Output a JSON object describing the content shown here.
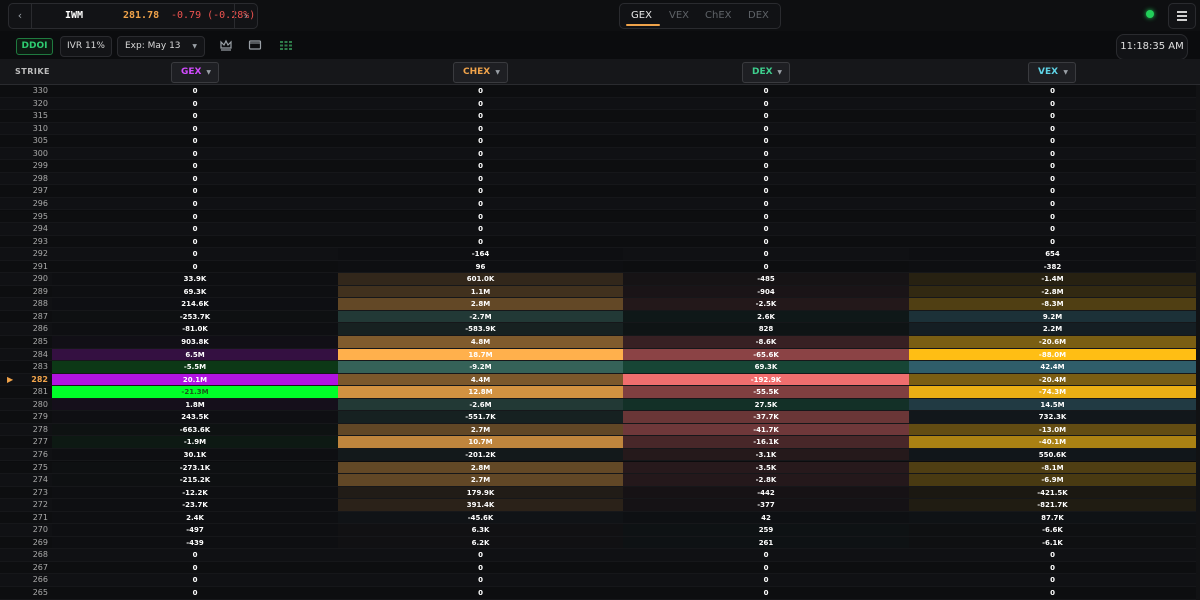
{
  "ticker": {
    "prev": "‹",
    "next": "›",
    "symbol": "IWM",
    "price": "281.78",
    "change": "-0.79 (-0.28%)"
  },
  "tabs": [
    {
      "label": "GEX",
      "active": true
    },
    {
      "label": "VEX",
      "active": false
    },
    {
      "label": "ChEX",
      "active": false
    },
    {
      "label": "DEX",
      "active": false
    }
  ],
  "toolbar": {
    "ddoi": "DDOI",
    "ivr": "IVR 11%",
    "expiry": "Exp: May 13",
    "time": "11:18:35 AM"
  },
  "columns": {
    "strike": "STRIKE",
    "gex": "GEX",
    "chex": "CHEX",
    "dex": "DEX",
    "vex": "VEX"
  },
  "colors": {
    "gex": "#d24bff",
    "chex": "#f0a34a",
    "dex": "#3ecf8e",
    "vex": "#5fd3e6",
    "accent": "#f0a34a",
    "live": "#22d05a"
  },
  "current_strike": "282",
  "rows": [
    {
      "strike": "330",
      "gex": "0",
      "chex": "0",
      "dex": "0",
      "vex": "0"
    },
    {
      "strike": "320",
      "gex": "0",
      "chex": "0",
      "dex": "0",
      "vex": "0"
    },
    {
      "strike": "315",
      "gex": "0",
      "chex": "0",
      "dex": "0",
      "vex": "0"
    },
    {
      "strike": "310",
      "gex": "0",
      "chex": "0",
      "dex": "0",
      "vex": "0"
    },
    {
      "strike": "305",
      "gex": "0",
      "chex": "0",
      "dex": "0",
      "vex": "0"
    },
    {
      "strike": "300",
      "gex": "0",
      "chex": "0",
      "dex": "0",
      "vex": "0"
    },
    {
      "strike": "299",
      "gex": "0",
      "chex": "0",
      "dex": "0",
      "vex": "0"
    },
    {
      "strike": "298",
      "gex": "0",
      "chex": "0",
      "dex": "0",
      "vex": "0"
    },
    {
      "strike": "297",
      "gex": "0",
      "chex": "0",
      "dex": "0",
      "vex": "0"
    },
    {
      "strike": "296",
      "gex": "0",
      "chex": "0",
      "dex": "0",
      "vex": "0"
    },
    {
      "strike": "295",
      "gex": "0",
      "chex": "0",
      "dex": "0",
      "vex": "0"
    },
    {
      "strike": "294",
      "gex": "0",
      "chex": "0",
      "dex": "0",
      "vex": "0"
    },
    {
      "strike": "293",
      "gex": "0",
      "chex": "0",
      "dex": "0",
      "vex": "0"
    },
    {
      "strike": "292",
      "gex": "0",
      "chex": "-164",
      "dex": "0",
      "vex": "654"
    },
    {
      "strike": "291",
      "gex": "0",
      "chex": "96",
      "dex": "0",
      "vex": "-382"
    },
    {
      "strike": "290",
      "gex": "33.9K",
      "chex": "601.0K",
      "dex": "-485",
      "vex": "-1.4M"
    },
    {
      "strike": "289",
      "gex": "69.3K",
      "chex": "1.1M",
      "dex": "-904",
      "vex": "-2.8M"
    },
    {
      "strike": "288",
      "gex": "214.6K",
      "chex": "2.8M",
      "dex": "-2.5K",
      "vex": "-8.3M"
    },
    {
      "strike": "287",
      "gex": "-253.7K",
      "chex": "-2.7M",
      "dex": "2.6K",
      "vex": "9.2M"
    },
    {
      "strike": "286",
      "gex": "-81.0K",
      "chex": "-583.9K",
      "dex": "828",
      "vex": "2.2M"
    },
    {
      "strike": "285",
      "gex": "903.8K",
      "chex": "4.8M",
      "dex": "-8.6K",
      "vex": "-20.6M"
    },
    {
      "strike": "284",
      "gex": "6.5M",
      "chex": "18.7M",
      "dex": "-65.6K",
      "vex": "-88.0M"
    },
    {
      "strike": "283",
      "gex": "-5.5M",
      "chex": "-9.2M",
      "dex": "69.3K",
      "vex": "42.4M"
    },
    {
      "strike": "282",
      "gex": "20.1M",
      "chex": "4.4M",
      "dex": "-192.9K",
      "vex": "-20.4M"
    },
    {
      "strike": "281",
      "gex": "-21.3M",
      "chex": "12.8M",
      "dex": "-55.5K",
      "vex": "-74.3M"
    },
    {
      "strike": "280",
      "gex": "1.8M",
      "chex": "-2.6M",
      "dex": "27.5K",
      "vex": "14.5M"
    },
    {
      "strike": "279",
      "gex": "243.5K",
      "chex": "-551.7K",
      "dex": "-37.7K",
      "vex": "732.3K"
    },
    {
      "strike": "278",
      "gex": "-663.6K",
      "chex": "2.7M",
      "dex": "-41.7K",
      "vex": "-13.0M"
    },
    {
      "strike": "277",
      "gex": "-1.9M",
      "chex": "10.7M",
      "dex": "-16.1K",
      "vex": "-40.1M"
    },
    {
      "strike": "276",
      "gex": "30.1K",
      "chex": "-201.2K",
      "dex": "-3.1K",
      "vex": "550.6K"
    },
    {
      "strike": "275",
      "gex": "-273.1K",
      "chex": "2.8M",
      "dex": "-3.5K",
      "vex": "-8.1M"
    },
    {
      "strike": "274",
      "gex": "-215.2K",
      "chex": "2.7M",
      "dex": "-2.8K",
      "vex": "-6.9M"
    },
    {
      "strike": "273",
      "gex": "-12.2K",
      "chex": "179.9K",
      "dex": "-442",
      "vex": "-421.5K"
    },
    {
      "strike": "272",
      "gex": "-23.7K",
      "chex": "391.4K",
      "dex": "-377",
      "vex": "-821.7K"
    },
    {
      "strike": "271",
      "gex": "2.4K",
      "chex": "-45.6K",
      "dex": "42",
      "vex": "87.7K"
    },
    {
      "strike": "270",
      "gex": "-497",
      "chex": "6.3K",
      "dex": "259",
      "vex": "-6.6K"
    },
    {
      "strike": "269",
      "gex": "-439",
      "chex": "6.2K",
      "dex": "261",
      "vex": "-6.1K"
    },
    {
      "strike": "268",
      "gex": "0",
      "chex": "0",
      "dex": "0",
      "vex": "0"
    },
    {
      "strike": "267",
      "gex": "0",
      "chex": "0",
      "dex": "0",
      "vex": "0"
    },
    {
      "strike": "266",
      "gex": "0",
      "chex": "0",
      "dex": "0",
      "vex": "0"
    },
    {
      "strike": "265",
      "gex": "0",
      "chex": "0",
      "dex": "0",
      "vex": "0"
    }
  ]
}
